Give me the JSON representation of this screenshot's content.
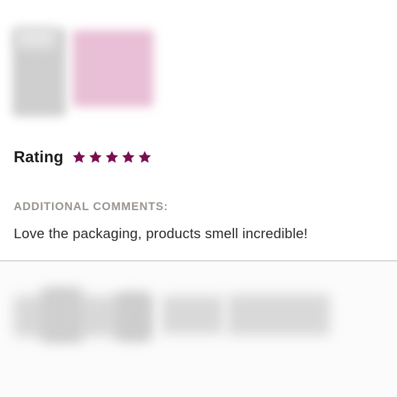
{
  "review": {
    "rating_label": "Rating",
    "rating_value": 5,
    "rating_max": 5,
    "star_color": "#7a0f4f",
    "comments_heading": "ADDITIONAL COMMENTS:",
    "comment_text": "Love the packaging, products smell incredible!"
  },
  "icons": {
    "star": "star-icon"
  }
}
